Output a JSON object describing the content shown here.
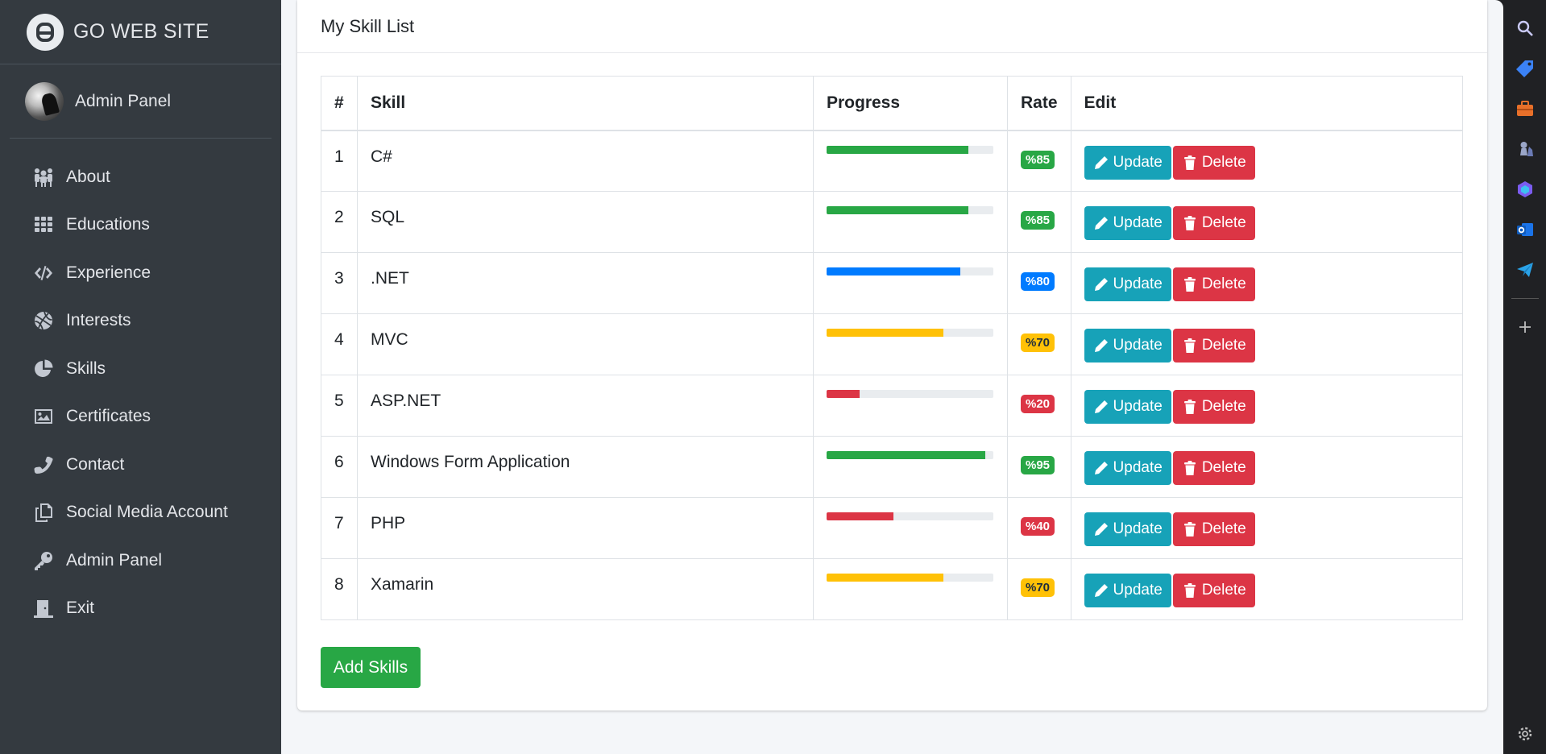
{
  "brand": {
    "title": "GO WEB SITE"
  },
  "user": {
    "name": "Admin Panel"
  },
  "nav": [
    {
      "label": "About",
      "icon": "users-icon"
    },
    {
      "label": "Educations",
      "icon": "grid-icon"
    },
    {
      "label": "Experience",
      "icon": "code-icon"
    },
    {
      "label": "Interests",
      "icon": "basketball-icon"
    },
    {
      "label": "Skills",
      "icon": "pie-chart-icon"
    },
    {
      "label": "Certificates",
      "icon": "image-icon"
    },
    {
      "label": "Contact",
      "icon": "phone-icon"
    },
    {
      "label": "Social Media Account",
      "icon": "copy-icon"
    },
    {
      "label": "Admin Panel",
      "icon": "key-icon"
    },
    {
      "label": "Exit",
      "icon": "door-icon"
    }
  ],
  "card": {
    "title": "My Skill List"
  },
  "table": {
    "headers": [
      "#",
      "Skill",
      "Progress",
      "Rate",
      "Edit"
    ],
    "rows": [
      {
        "id": "1",
        "skill": "C#",
        "progress": 85,
        "rate": "%85",
        "color": "#28a745",
        "dark_text": false
      },
      {
        "id": "2",
        "skill": "SQL",
        "progress": 85,
        "rate": "%85",
        "color": "#28a745",
        "dark_text": false
      },
      {
        "id": "3",
        "skill": ".NET",
        "progress": 80,
        "rate": "%80",
        "color": "#007bff",
        "dark_text": false
      },
      {
        "id": "4",
        "skill": "MVC",
        "progress": 70,
        "rate": "%70",
        "color": "#ffc107",
        "dark_text": true
      },
      {
        "id": "5",
        "skill": "ASP.NET",
        "progress": 20,
        "rate": "%20",
        "color": "#dc3545",
        "dark_text": false
      },
      {
        "id": "6",
        "skill": "Windows Form Application",
        "progress": 95,
        "rate": "%95",
        "color": "#28a745",
        "dark_text": false
      },
      {
        "id": "7",
        "skill": "PHP",
        "progress": 40,
        "rate": "%40",
        "color": "#dc3545",
        "dark_text": false
      },
      {
        "id": "8",
        "skill": "Xamarin",
        "progress": 70,
        "rate": "%70",
        "color": "#ffc107",
        "dark_text": true
      }
    ],
    "update_label": "Update",
    "delete_label": "Delete"
  },
  "add_button": {
    "label": "Add Skills"
  },
  "rail": [
    {
      "icon": "search-icon"
    },
    {
      "icon": "tag-icon"
    },
    {
      "icon": "briefcase-icon"
    },
    {
      "icon": "chess-icon"
    },
    {
      "icon": "copilot-icon"
    },
    {
      "icon": "outlook-icon"
    },
    {
      "icon": "send-icon"
    },
    {
      "icon": "plus-icon"
    },
    {
      "icon": "settings-icon"
    }
  ]
}
